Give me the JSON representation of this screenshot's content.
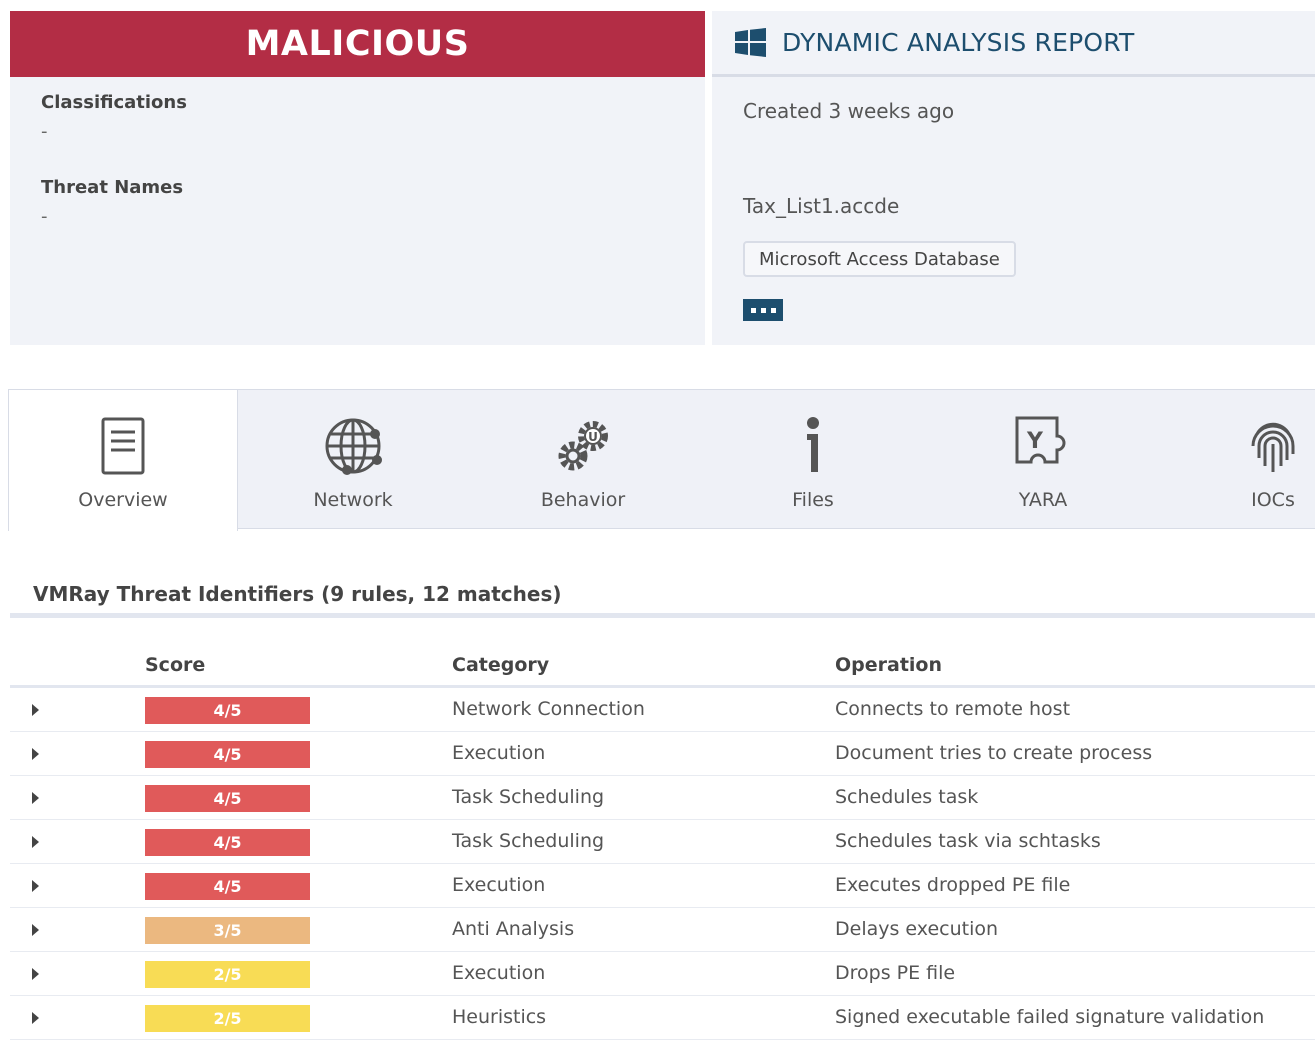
{
  "verdict": {
    "label": "MALICIOUS",
    "color": "#b32d45",
    "classifications_label": "Classifications",
    "classifications_value": "-",
    "threat_names_label": "Threat Names",
    "threat_names_value": "-"
  },
  "report": {
    "icon": "windows-icon",
    "title": "DYNAMIC ANALYSIS REPORT",
    "created": "Created 3 weeks ago",
    "filename": "Tax_List1.accde",
    "file_type": "Microsoft Access Database",
    "accent_color": "#1d4e6e"
  },
  "tabs": [
    {
      "label": "Overview",
      "icon": "document-icon",
      "active": true
    },
    {
      "label": "Network",
      "icon": "globe-icon",
      "active": false
    },
    {
      "label": "Behavior",
      "icon": "gears-icon",
      "active": false
    },
    {
      "label": "Files",
      "icon": "info-icon",
      "active": false
    },
    {
      "label": "YARA",
      "icon": "yara-icon",
      "active": false
    },
    {
      "label": "IOCs",
      "icon": "fingerprint-icon",
      "active": false
    }
  ],
  "vti": {
    "title": "VMRay Threat Identifiers (9 rules, 12 matches)",
    "columns": {
      "score": "Score",
      "category": "Category",
      "operation": "Operation"
    },
    "score_colors": {
      "4": "#e05a5a",
      "3": "#ebb880",
      "2": "#f8dc55"
    },
    "rows": [
      {
        "score": "4/5",
        "category": "Network Connection",
        "operation": "Connects to remote host"
      },
      {
        "score": "4/5",
        "category": "Execution",
        "operation": "Document tries to create process"
      },
      {
        "score": "4/5",
        "category": "Task Scheduling",
        "operation": "Schedules task"
      },
      {
        "score": "4/5",
        "category": "Task Scheduling",
        "operation": "Schedules task via schtasks"
      },
      {
        "score": "4/5",
        "category": "Execution",
        "operation": "Executes dropped PE file"
      },
      {
        "score": "3/5",
        "category": "Anti Analysis",
        "operation": "Delays execution"
      },
      {
        "score": "2/5",
        "category": "Execution",
        "operation": "Drops PE file"
      },
      {
        "score": "2/5",
        "category": "Heuristics",
        "operation": "Signed executable failed signature validation"
      }
    ]
  }
}
